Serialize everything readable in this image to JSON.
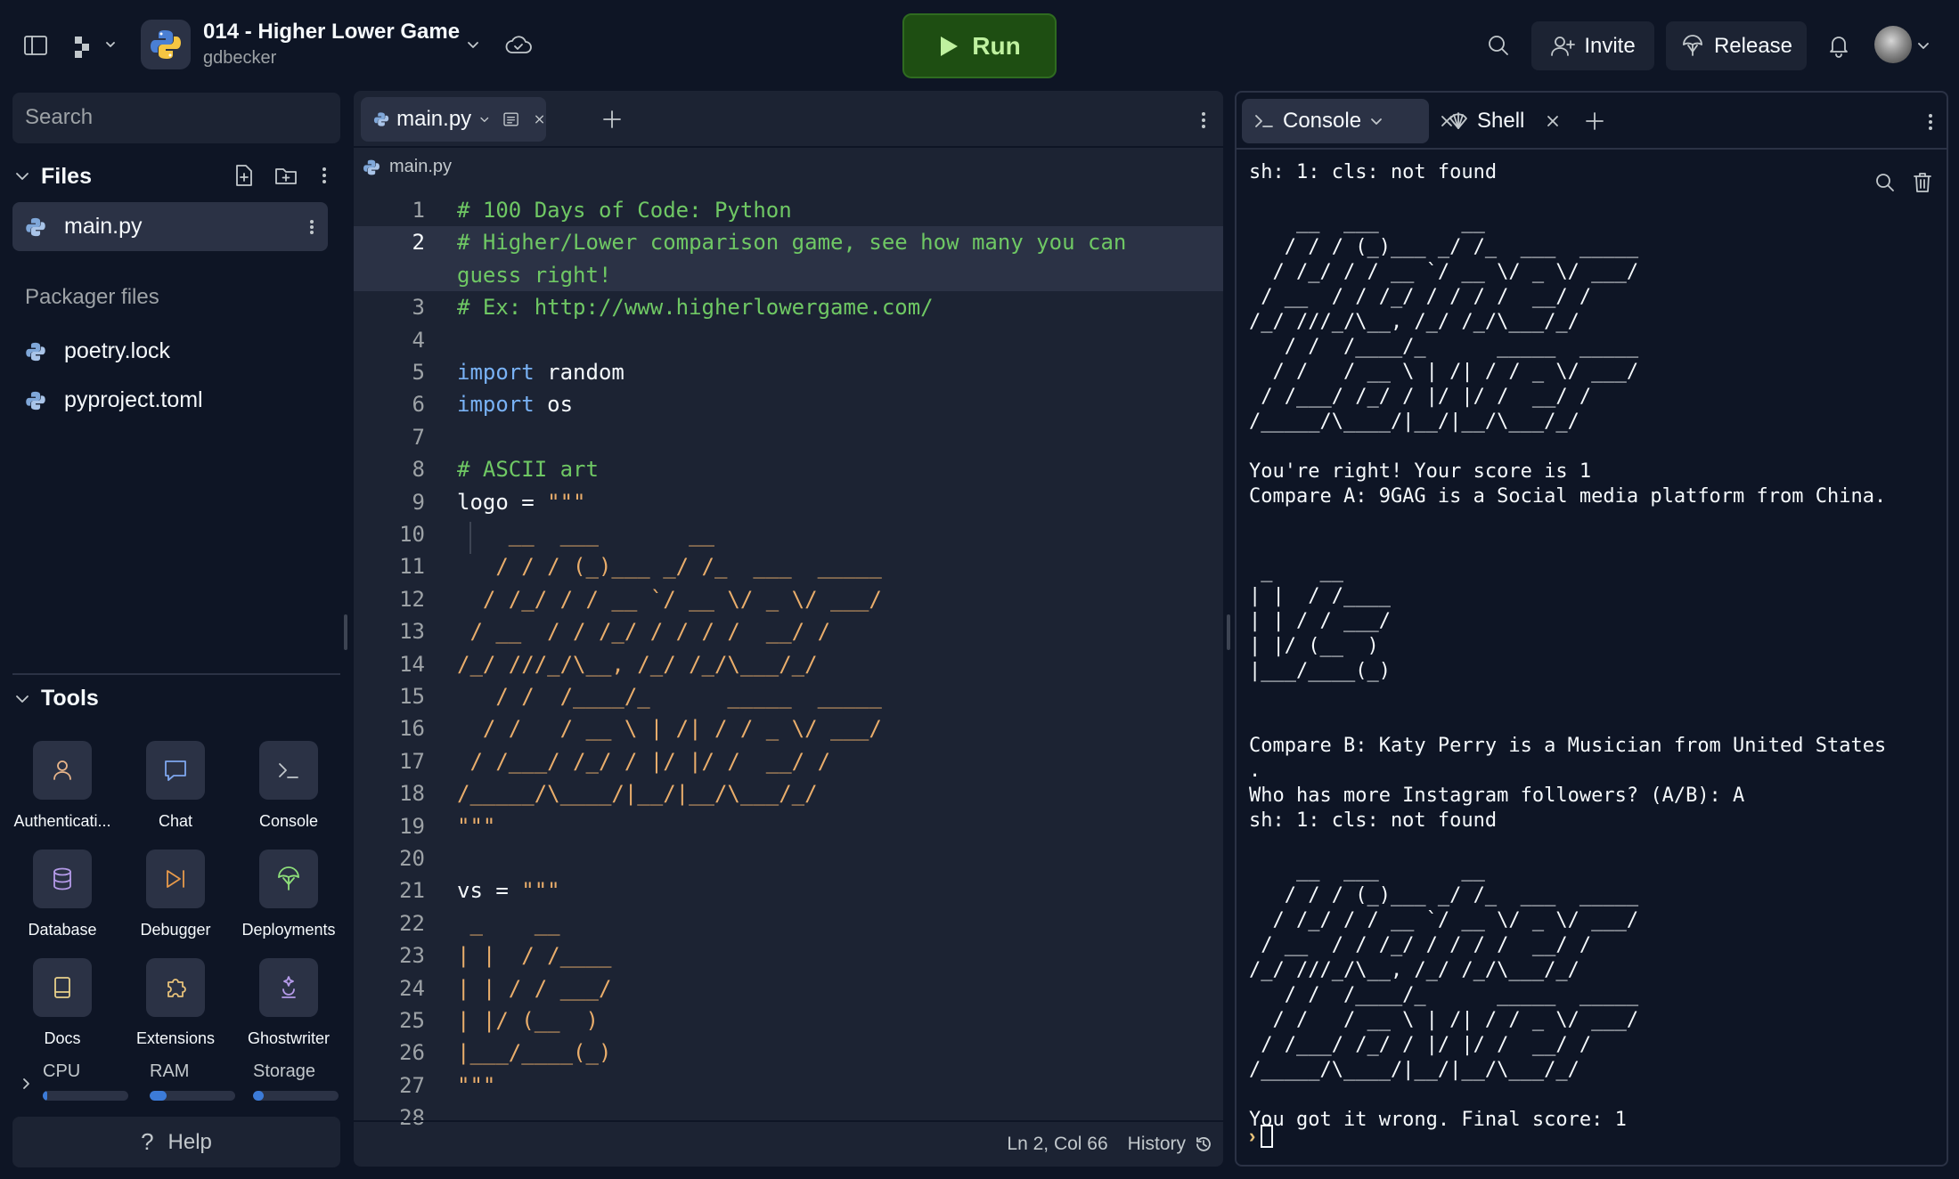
{
  "colors": {
    "background": "#0e1525",
    "panel": "#1c2333",
    "surface": "#2b3245",
    "run_button": "#1e4e12",
    "run_text": "#bff19f",
    "comment": "#6fc864",
    "keyword": "#79b2f5",
    "string": "#e9ad6b",
    "accent": "#3c7bd8"
  },
  "header": {
    "repl_title": "014 - Higher Lower Game",
    "repl_owner": "gdbecker",
    "run_label": "Run",
    "invite_label": "Invite",
    "release_label": "Release"
  },
  "sidebar": {
    "search_placeholder": "Search",
    "files_title": "Files",
    "files": [
      {
        "name": "main.py",
        "icon": "python-icon",
        "active": true
      }
    ],
    "packager_title": "Packager files",
    "packager_files": [
      {
        "name": "poetry.lock",
        "icon": "python-icon"
      },
      {
        "name": "pyproject.toml",
        "icon": "python-icon"
      }
    ],
    "tools_title": "Tools",
    "tools": [
      {
        "label": "Authenticati...",
        "icon": "user-icon"
      },
      {
        "label": "Chat",
        "icon": "chat-icon"
      },
      {
        "label": "Console",
        "icon": "terminal-icon"
      },
      {
        "label": "Database",
        "icon": "database-icon"
      },
      {
        "label": "Debugger",
        "icon": "debugger-icon"
      },
      {
        "label": "Deployments",
        "icon": "deployments-icon"
      },
      {
        "label": "Docs",
        "icon": "book-icon"
      },
      {
        "label": "Extensions",
        "icon": "puzzle-icon"
      },
      {
        "label": "Ghostwriter",
        "icon": "ghostwriter-icon"
      }
    ],
    "resources": [
      {
        "label": "CPU",
        "usage": 0.05
      },
      {
        "label": "RAM",
        "usage": 0.2
      },
      {
        "label": "Storage",
        "usage": 0.12
      }
    ],
    "help_label": "Help"
  },
  "editor": {
    "tab_label": "main.py",
    "breadcrumb": "main.py",
    "current_line": 2,
    "lines": [
      {
        "n": "1",
        "parts": [
          {
            "t": "# 100 Days of Code: Python",
            "c": "com"
          }
        ]
      },
      {
        "n": "2",
        "parts": [
          {
            "t": "# Higher/Lower comparison game, see how many you can",
            "c": "com"
          }
        ]
      },
      {
        "n": "",
        "parts": [
          {
            "t": "guess right!",
            "c": "com"
          }
        ]
      },
      {
        "n": "3",
        "parts": [
          {
            "t": "# Ex: http://www.higherlowergame.com/",
            "c": "com"
          }
        ]
      },
      {
        "n": "4",
        "parts": []
      },
      {
        "n": "5",
        "parts": [
          {
            "t": "import",
            "c": "kw"
          },
          {
            "t": " random",
            "c": ""
          }
        ]
      },
      {
        "n": "6",
        "parts": [
          {
            "t": "import",
            "c": "kw"
          },
          {
            "t": " os",
            "c": ""
          }
        ]
      },
      {
        "n": "7",
        "parts": []
      },
      {
        "n": "8",
        "parts": [
          {
            "t": "# ASCII art",
            "c": "com"
          }
        ]
      },
      {
        "n": "9",
        "parts": [
          {
            "t": "logo = ",
            "c": ""
          },
          {
            "t": "\"\"\"",
            "c": "str"
          }
        ]
      },
      {
        "n": "10",
        "parts": [
          {
            "t": "    __  ___       __",
            "c": "str"
          }
        ]
      },
      {
        "n": "11",
        "parts": [
          {
            "t": "   / / / (_)___ _/ /_  ___  _____",
            "c": "str"
          }
        ]
      },
      {
        "n": "12",
        "parts": [
          {
            "t": "  / /_/ / / __ `/ __ \\/ _ \\/ ___/",
            "c": "str"
          }
        ]
      },
      {
        "n": "13",
        "parts": [
          {
            "t": " / __  / / /_/ / / / /  __/ /",
            "c": "str"
          }
        ]
      },
      {
        "n": "14",
        "parts": [
          {
            "t": "/_/ ///_/\\__, /_/ /_/\\___/_/",
            "c": "str"
          }
        ]
      },
      {
        "n": "15",
        "parts": [
          {
            "t": "   / /  /____/_      _____  _____",
            "c": "str"
          }
        ]
      },
      {
        "n": "16",
        "parts": [
          {
            "t": "  / /   / __ \\ | /| / / _ \\/ ___/",
            "c": "str"
          }
        ]
      },
      {
        "n": "17",
        "parts": [
          {
            "t": " / /___/ /_/ / |/ |/ /  __/ /",
            "c": "str"
          }
        ]
      },
      {
        "n": "18",
        "parts": [
          {
            "t": "/_____/\\____/|__/|__/\\___/_/",
            "c": "str"
          }
        ]
      },
      {
        "n": "19",
        "parts": [
          {
            "t": "\"\"\"",
            "c": "str"
          }
        ]
      },
      {
        "n": "20",
        "parts": []
      },
      {
        "n": "21",
        "parts": [
          {
            "t": "vs = ",
            "c": ""
          },
          {
            "t": "\"\"\"",
            "c": "str"
          }
        ]
      },
      {
        "n": "22",
        "parts": [
          {
            "t": " _    __",
            "c": "str"
          }
        ]
      },
      {
        "n": "23",
        "parts": [
          {
            "t": "| |  / /____",
            "c": "str"
          }
        ]
      },
      {
        "n": "24",
        "parts": [
          {
            "t": "| | / / ___/",
            "c": "str"
          }
        ]
      },
      {
        "n": "25",
        "parts": [
          {
            "t": "| |/ (__  )",
            "c": "str"
          }
        ]
      },
      {
        "n": "26",
        "parts": [
          {
            "t": "|___/____(_)",
            "c": "str"
          }
        ]
      },
      {
        "n": "27",
        "parts": [
          {
            "t": "\"\"\"",
            "c": "str"
          }
        ]
      },
      {
        "n": "28",
        "parts": []
      }
    ],
    "status_position": "Ln 2, Col 66",
    "history_label": "History"
  },
  "console": {
    "tab_console": "Console",
    "tab_shell": "Shell",
    "output": "sh: 1: cls: not found\n\n    __  ___       __\n   / / / (_)___ _/ /_  ___  _____\n  / /_/ / / __ `/ __ \\/ _ \\/ ___/\n / __  / / /_/ / / / /  __/ /\n/_/ ///_/\\__, /_/ /_/\\___/_/\n   / /  /____/_      _____  _____\n  / /   / __ \\ | /| / / _ \\/ ___/\n / /___/ /_/ / |/ |/ /  __/ /\n/_____/\\____/|__/|__/\\___/_/\n\nYou're right! Your score is 1\nCompare A: 9GAG is a Social media platform from China.\n\n\n _    __\n| |  / /____\n| | / / ___/\n| |/ (__  )\n|___/____(_)\n\n\nCompare B: Katy Perry is a Musician from United States\n.\nWho has more Instagram followers? (A/B): A\nsh: 1: cls: not found\n\n    __  ___       __\n   / / / (_)___ _/ /_  ___  _____\n  / /_/ / / __ `/ __ \\/ _ \\/ ___/\n / __  / / /_/ / / / /  __/ /\n/_/ ///_/\\__, /_/ /_/\\___/_/\n   / /  /____/_      _____  _____\n  / /   / __ \\ | /| / / _ \\/ ___/\n / /___/ /_/ / |/ |/ /  __/ /\n/_____/\\____/|__/|__/\\___/_/\n\nYou got it wrong. Final score: 1",
    "prompt_symbol": "›"
  }
}
